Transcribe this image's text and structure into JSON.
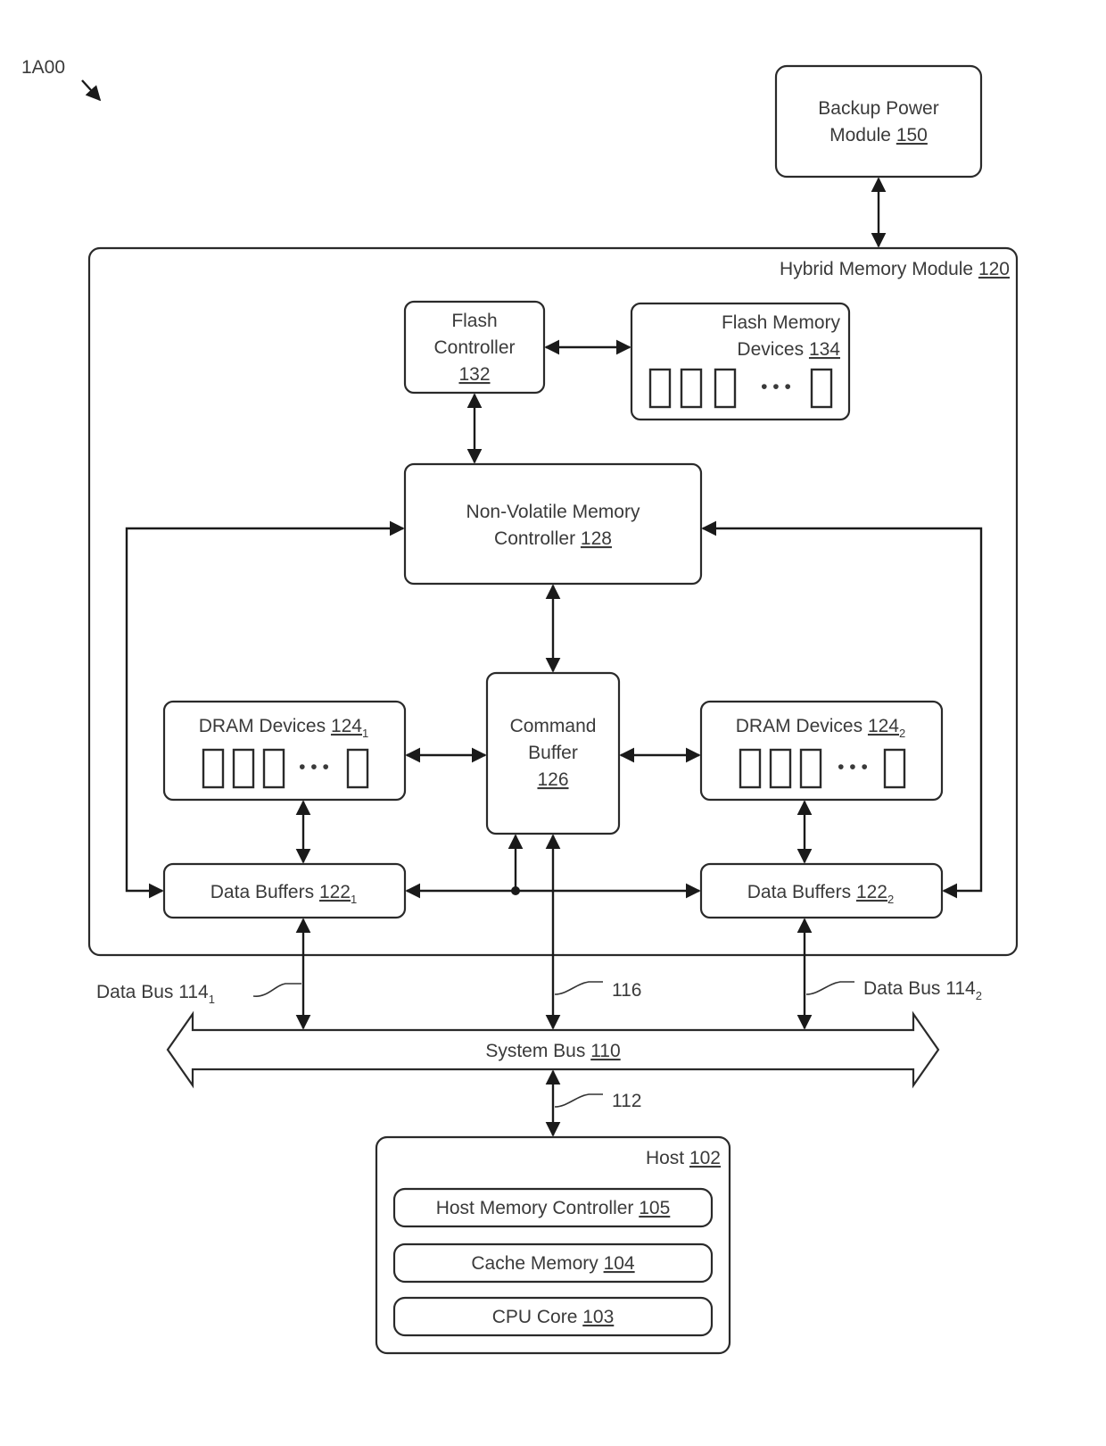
{
  "figure": {
    "id_label": "1A00",
    "accent_color": "#2a2a2a"
  },
  "nodes": {
    "backup_power": {
      "line1": "Backup Power",
      "line2_text": "Module ",
      "ref": "150"
    },
    "hybrid_module": {
      "text": "Hybrid Memory Module ",
      "ref": "120"
    },
    "flash_controller": {
      "line1": "Flash",
      "line2": "Controller",
      "ref": "132"
    },
    "flash_devices": {
      "line1": "Flash Memory",
      "line2_text": "Devices ",
      "ref": "134"
    },
    "nvm_controller": {
      "line1": "Non-Volatile Memory",
      "line2_text": "Controller ",
      "ref": "128"
    },
    "dram_1": {
      "text": "DRAM Devices ",
      "ref": "124",
      "sub": "1"
    },
    "dram_2": {
      "text": "DRAM Devices ",
      "ref": "124",
      "sub": "2"
    },
    "command_buffer": {
      "line1": "Command",
      "line2": "Buffer",
      "ref": "126"
    },
    "data_buffers_1": {
      "text": "Data Buffers ",
      "ref": "122",
      "sub": "1"
    },
    "data_buffers_2": {
      "text": "Data Buffers ",
      "ref": "122",
      "sub": "2"
    },
    "system_bus": {
      "text": "System Bus ",
      "ref": "110"
    },
    "host": {
      "text": "Host ",
      "ref": "102"
    },
    "host_memory_controller": {
      "text": "Host Memory Controller ",
      "ref": "105"
    },
    "cache_memory": {
      "text": "Cache Memory ",
      "ref": "104"
    },
    "cpu_core": {
      "text": "CPU Core ",
      "ref": "103"
    }
  },
  "callouts": {
    "data_bus_1": {
      "text": "Data Bus 114",
      "sub": "1"
    },
    "data_bus_2": {
      "text": "Data Bus 114",
      "sub": "2"
    },
    "cmd_bus": {
      "text": "116"
    },
    "host_link": {
      "text": "112"
    }
  },
  "ellipsis": "• • •"
}
